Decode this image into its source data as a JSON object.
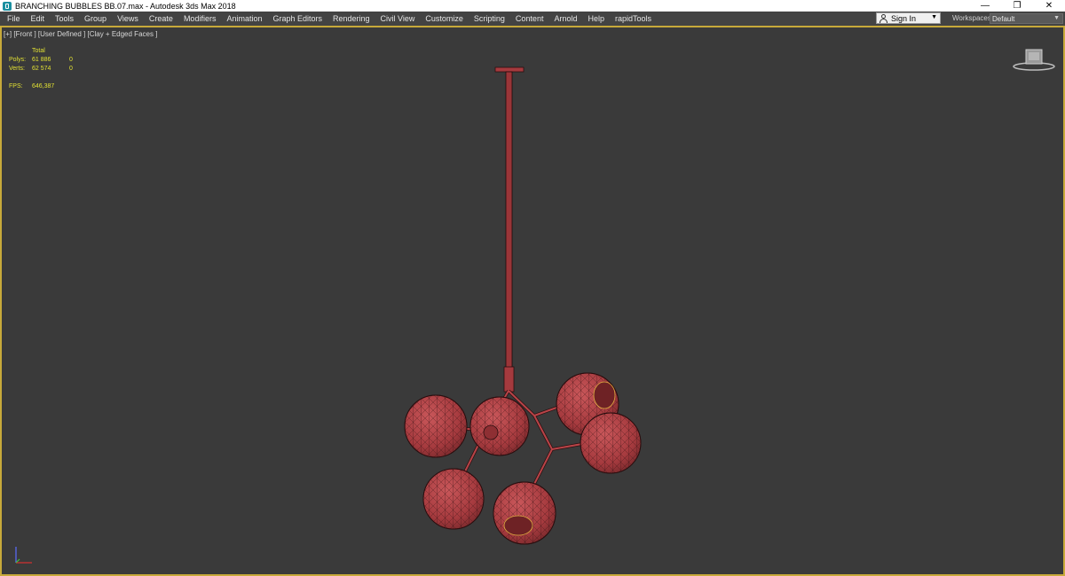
{
  "window": {
    "title": "BRANCHING BUBBLES BB.07.max - Autodesk 3ds Max 2018",
    "app_icon": "3dsmax-icon",
    "controls": {
      "minimize": "—",
      "restore": "❐",
      "close": "✕"
    }
  },
  "menu": {
    "items": [
      "File",
      "Edit",
      "Tools",
      "Group",
      "Views",
      "Create",
      "Modifiers",
      "Animation",
      "Graph Editors",
      "Rendering",
      "Civil View",
      "Customize",
      "Scripting",
      "Content",
      "Arnold",
      "Help",
      "rapidTools"
    ],
    "sign_in": "Sign In",
    "workspaces_label": "Workspaces:",
    "workspaces_value": "Default"
  },
  "viewport": {
    "label": "[+] [Front ] [User Defined ] [Clay + Edged Faces ]",
    "stats": {
      "header": "Total",
      "polys_label": "Polys:",
      "polys_total": "61 886",
      "polys_sel": "0",
      "verts_label": "Verts:",
      "verts_total": "62 574",
      "verts_sel": "0",
      "fps_label": "FPS:",
      "fps_value": "646,387"
    },
    "model_color": "#b84448",
    "active_border_color": "#c7a93a"
  }
}
